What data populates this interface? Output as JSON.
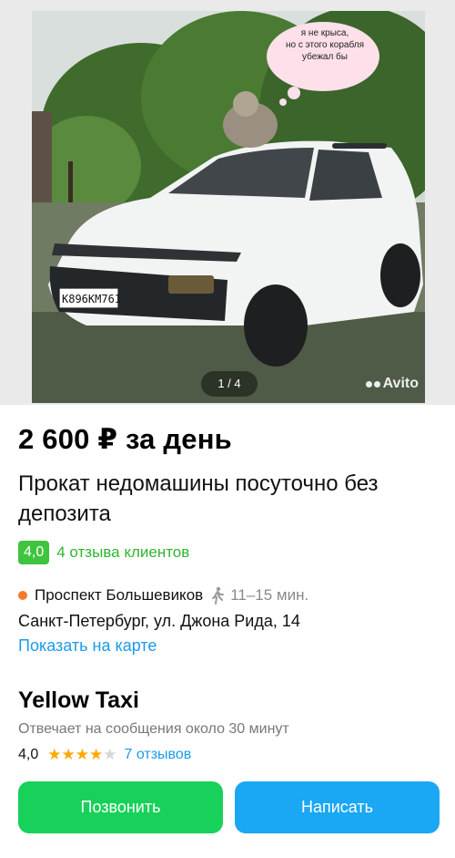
{
  "gallery": {
    "counter": "1 / 4",
    "watermark": "Avito",
    "speech_bubble_lines": [
      "я не крыса,",
      "но с этого корабля",
      "убежал бы"
    ],
    "license_plate": "К896КМ761"
  },
  "listing": {
    "price": "2 600 ₽ за день",
    "title": "Прокат недомашины посуточно без депозита",
    "rating_value": "4,0",
    "rating_link": "4 отзыва клиентов",
    "metro_station": "Проспект Большевиков",
    "walk_time": "11–15 мин.",
    "address": "Санкт-Петербург, ул. Джона Рида, 14",
    "map_link": "Показать на карте"
  },
  "seller": {
    "name": "Yellow Taxi",
    "reply_time": "Отвечает на сообщения около 30 минут",
    "rating": "4,0",
    "stars_filled": 4,
    "stars_total": 5,
    "reviews_link": "7 отзывов"
  },
  "actions": {
    "call_label": "Позвонить",
    "write_label": "Написать"
  },
  "colors": {
    "call_button": "#18d15a",
    "write_button": "#1aa7f3",
    "rating_badge": "#3ec43e",
    "link": "#1a9bea",
    "metro_dot": "#f37a2a",
    "star": "#ffa800"
  }
}
